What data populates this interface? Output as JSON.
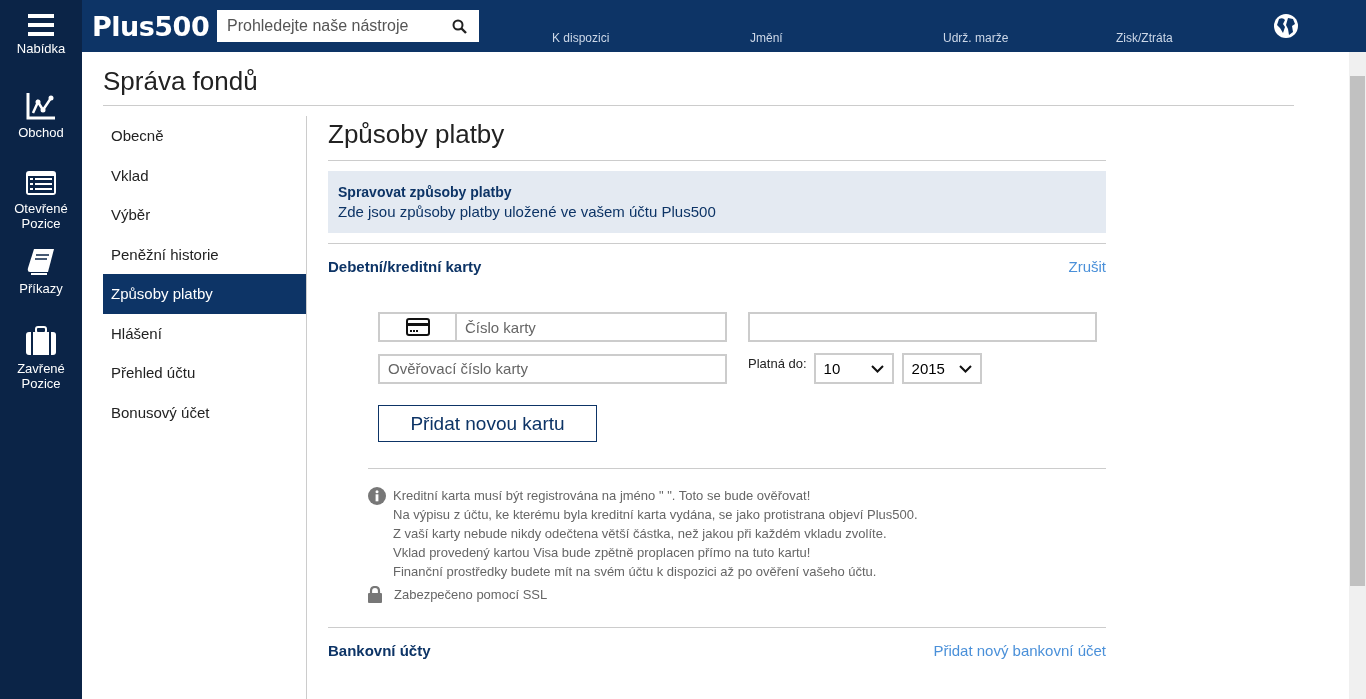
{
  "side_nav": [
    {
      "label": "Nabídka",
      "kind": "menu"
    },
    {
      "label": "Obchod",
      "kind": "chart"
    },
    {
      "label": "Otevřené Pozice",
      "kind": "list"
    },
    {
      "label": "Příkazy",
      "kind": "book"
    },
    {
      "label": "Zavřené Pozice",
      "kind": "case"
    }
  ],
  "top_bar": {
    "logo": "Plus500",
    "search": {
      "placeholder": "Prohledejte naše nástroje"
    },
    "stats": [
      "K dispozici",
      "Jmění",
      "Udrž. marže",
      "Zisk/Ztráta"
    ]
  },
  "page_title": "Správa fondů",
  "menu": [
    {
      "label": "Obecně",
      "selected": false
    },
    {
      "label": "Vklad",
      "selected": false
    },
    {
      "label": "Výběr",
      "selected": false
    },
    {
      "label": "Peněžní historie",
      "selected": false
    },
    {
      "label": "Způsoby platby",
      "selected": true
    },
    {
      "label": "Hlášení",
      "selected": false
    },
    {
      "label": "Přehled účtu",
      "selected": false
    },
    {
      "label": "Bonusový účet",
      "selected": false
    }
  ],
  "section_title": "Způsoby platby",
  "info": {
    "title": "Spravovat způsoby platby",
    "text": "Zde jsou způsoby platby uložené ve vašem účtu Plus500"
  },
  "cards": {
    "title": "Debetní/kreditní karty",
    "cancel": "Zrušit",
    "card_number": {
      "placeholder": "Číslo karty"
    },
    "cvv": {
      "placeholder": "Ověřovací číslo karty"
    },
    "expiry_label": "Platná do:",
    "month": "10",
    "year": "2015",
    "add_button": "Přidat novou kartu",
    "notes": [
      "Kreditní karta musí být registrována na jméno \" \". Toto se bude ověřovat!",
      "Na výpisu z účtu, ke kterému byla kreditní karta vydána, se jako protistrana objeví Plus500.",
      "Z vaší karty nebude nikdy odečtena větší částka, než jakou při každém vkladu zvolíte.",
      "Vklad provedený kartou Visa bude zpětně proplacen přímo na tuto kartu!",
      "Finanční prostředky budete mít na svém účtu k dispozici až po ověření vašeho účtu."
    ],
    "ssl": "Zabezpečeno pomocí SSL"
  },
  "bank": {
    "title": "Bankovní účty",
    "add_link": "Přidat nový bankovní účet"
  }
}
